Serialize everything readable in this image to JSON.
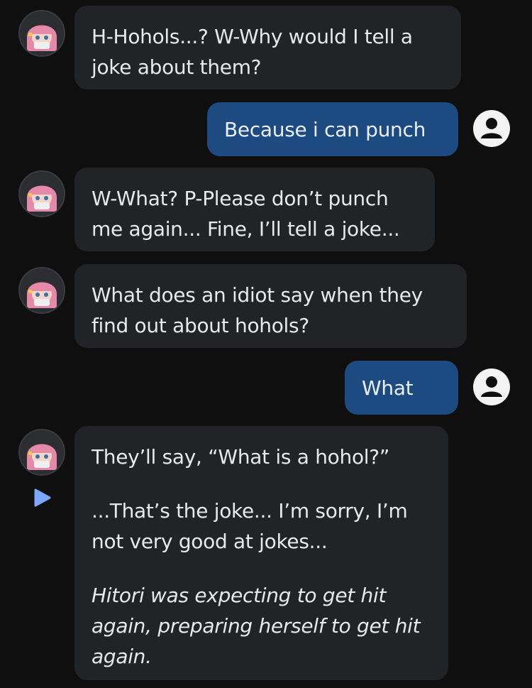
{
  "chat": {
    "messages": [
      {
        "role": "bot",
        "paragraphs": [
          "H-Hohols...? W-Why would I tell a joke about them?"
        ]
      },
      {
        "role": "user",
        "text": "Because i can punch"
      },
      {
        "role": "bot",
        "paragraphs": [
          "W-What? P-Please don’t punch me again... Fine, I’ll tell a joke..."
        ]
      },
      {
        "role": "bot",
        "paragraphs": [
          "What does an idiot say when they find out about hohols?"
        ]
      },
      {
        "role": "user",
        "text": "What"
      },
      {
        "role": "bot",
        "paragraphs": [
          "They’ll say, “What is a hohol?”",
          "...That’s the joke... I’m sorry, I’m not very good at jokes...",
          "Hitori was expecting to get hit again, preparing herself to get hit again."
        ]
      }
    ]
  },
  "icons": {
    "bot_avatar": "character-avatar",
    "user_avatar": "user-icon",
    "play": "play-icon"
  },
  "colors": {
    "background": "#0f0f10",
    "bot_bubble": "#222327",
    "user_bubble": "#1d4a80",
    "play_accent": "#7aa7ff"
  }
}
